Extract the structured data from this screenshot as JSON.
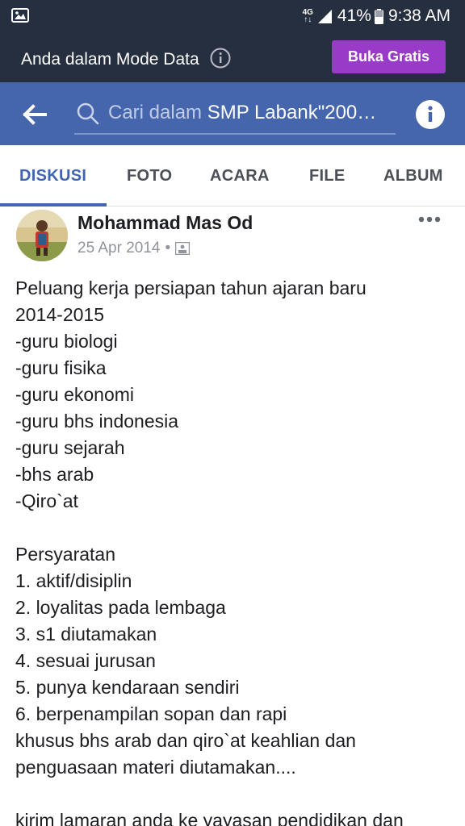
{
  "status_bar": {
    "network": "4G",
    "battery": "41%",
    "time": "9:38 AM"
  },
  "data_banner": {
    "message": "Anda dalam Mode Data",
    "button": "Buka Gratis"
  },
  "header": {
    "search_placeholder": "Cari dalam ",
    "search_group": "SMP Labank\"200…"
  },
  "tabs": [
    "DISKUSI",
    "FOTO",
    "ACARA",
    "FILE",
    "ALBUM"
  ],
  "post": {
    "author": "Mohammad Mas Od",
    "date": "25 Apr 2014",
    "dot": "•",
    "lines": [
      "Peluang kerja persiapan tahun ajaran baru",
      "2014-2015",
      "-guru biologi",
      "-guru fisika",
      "-guru ekonomi",
      "-guru bhs indonesia",
      "-guru sejarah",
      "-bhs arab",
      "-Qiro`at",
      "",
      "Persyaratan",
      "1. aktif/disiplin",
      "2. loyalitas pada lembaga",
      "3. s1 diutamakan",
      "4. sesuai jurusan",
      "5. punya kendaraan sendiri",
      "6. berpenampilan sopan dan rapi",
      "khusus bhs arab dan qiro`at keahlian dan",
      "penguasaan materi diutamakan....",
      "",
      "kirim lamaran anda ke yayasan pendidikan dan"
    ]
  },
  "colors": {
    "status_bg": "#262f40",
    "header_bg": "#4566ad",
    "button_purple": "#9a3ac9",
    "tab_active": "#4166b1"
  }
}
